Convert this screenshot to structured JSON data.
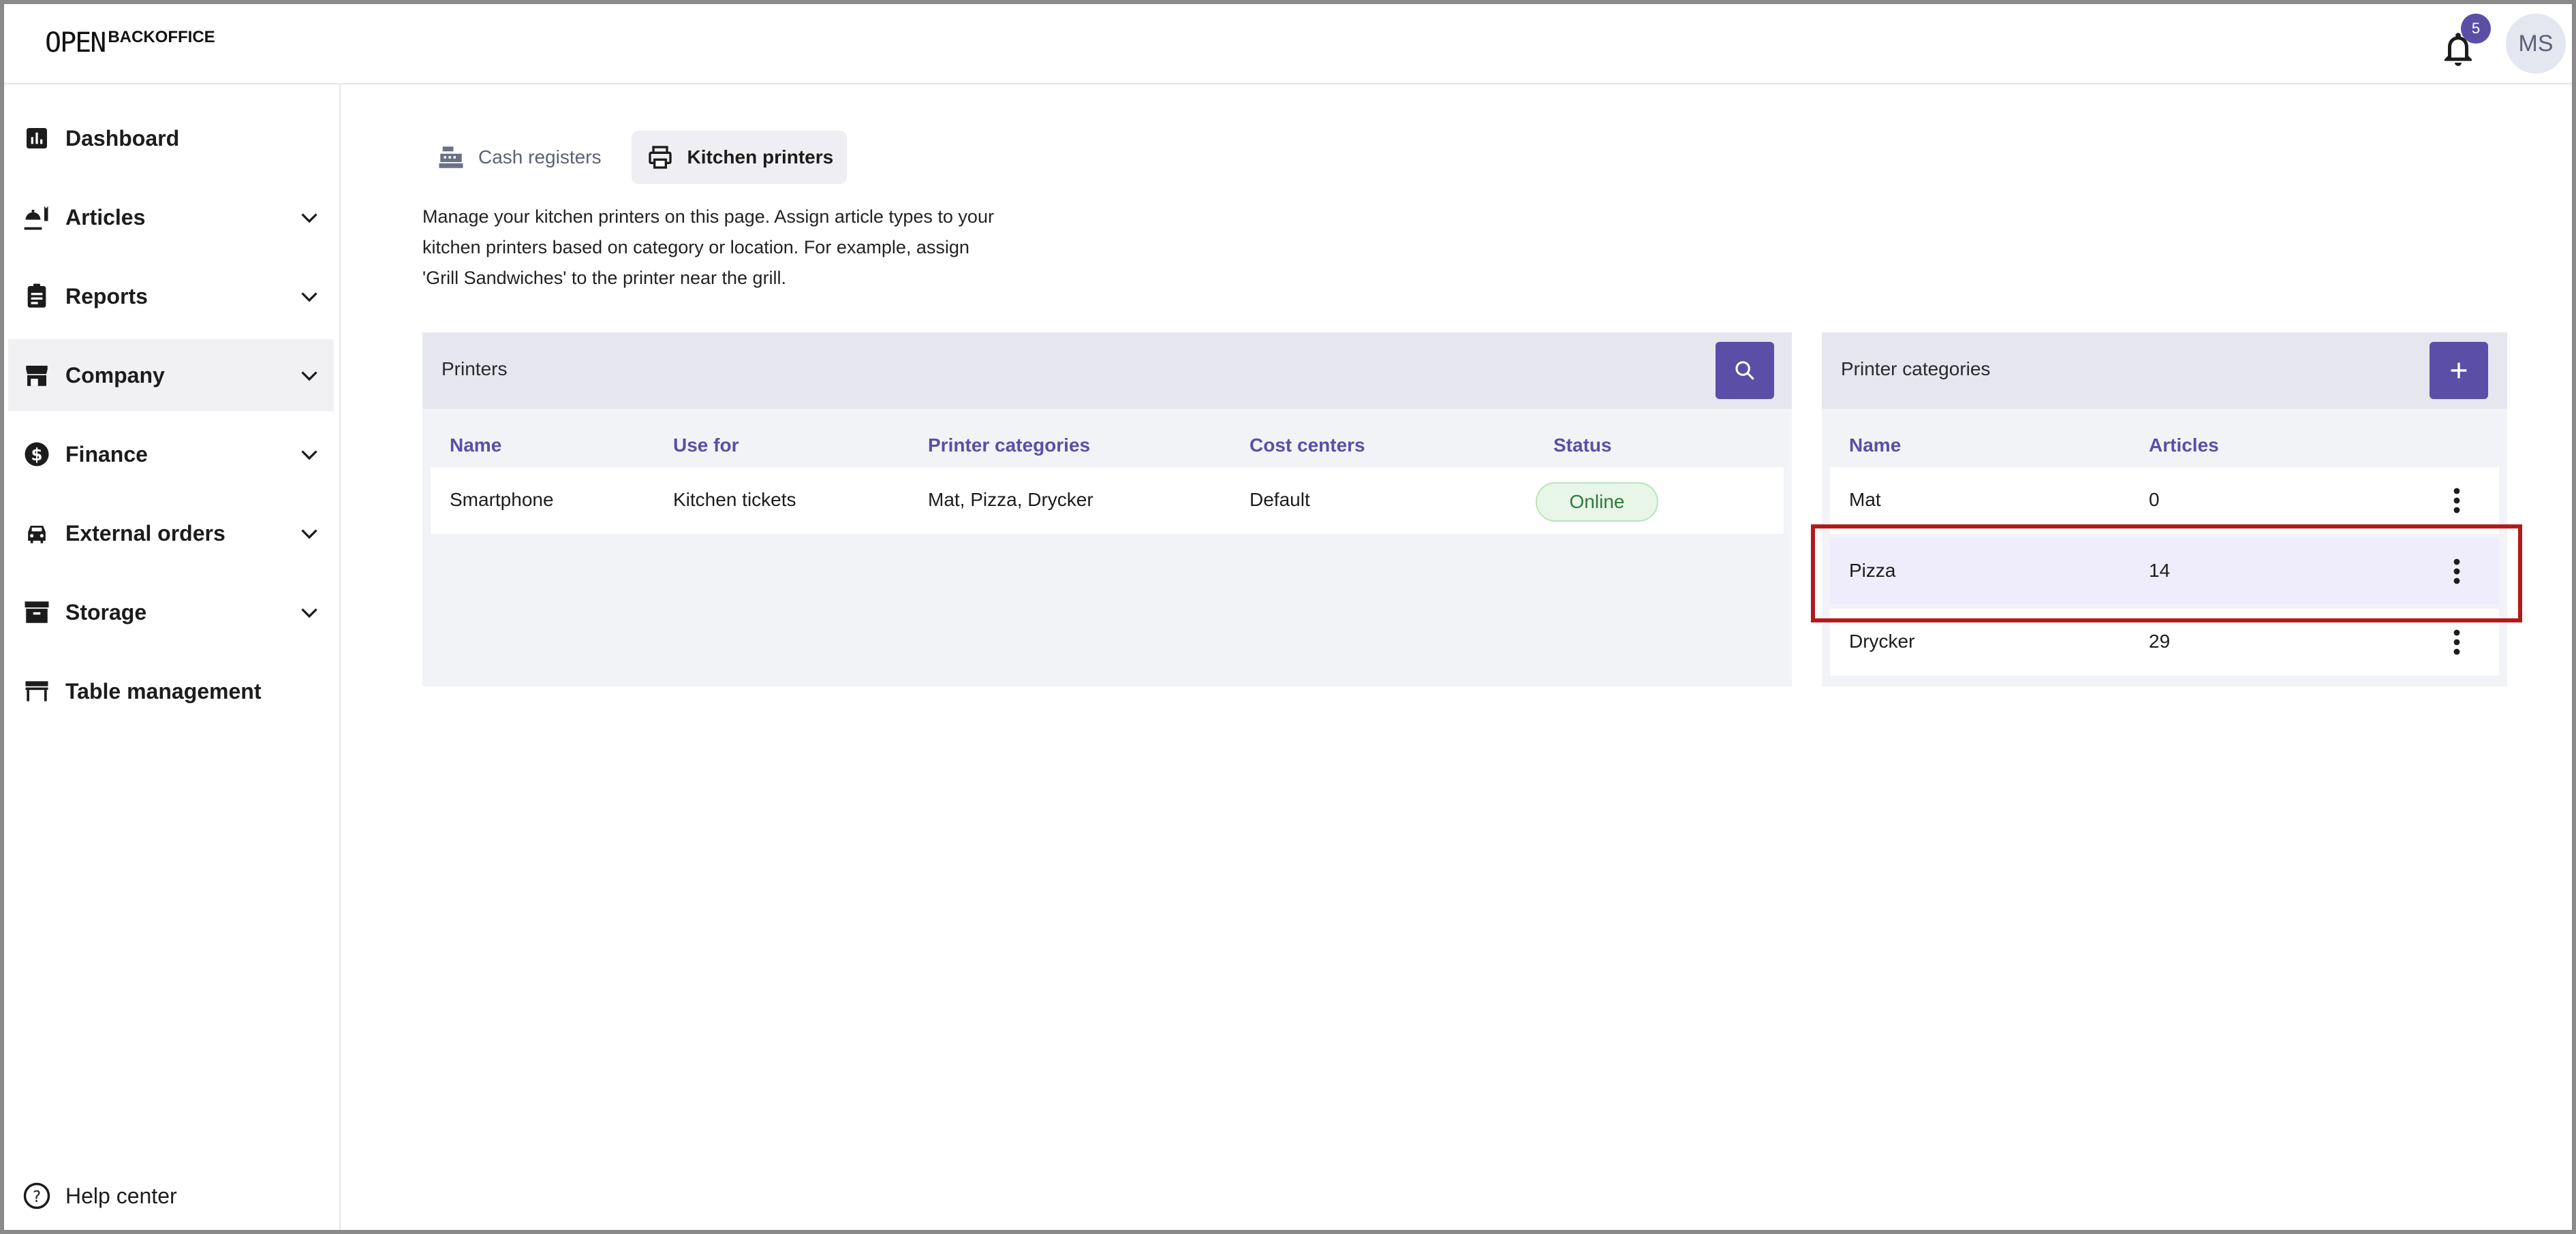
{
  "header": {
    "logo_mark": "OPEN",
    "logo_text": "BACKOFFICE",
    "notifications_count": "5",
    "avatar_initials": "MS"
  },
  "sidebar": {
    "items": [
      {
        "label": "Dashboard",
        "icon": "bar-chart-icon",
        "expandable": false
      },
      {
        "label": "Articles",
        "icon": "food-icon",
        "expandable": true
      },
      {
        "label": "Reports",
        "icon": "clipboard-icon",
        "expandable": true
      },
      {
        "label": "Company",
        "icon": "store-icon",
        "expandable": true,
        "active": true
      },
      {
        "label": "Finance",
        "icon": "dollar-icon",
        "expandable": true
      },
      {
        "label": "External orders",
        "icon": "car-icon",
        "expandable": true
      },
      {
        "label": "Storage",
        "icon": "archive-icon",
        "expandable": true
      },
      {
        "label": "Table management",
        "icon": "table-icon",
        "expandable": false
      }
    ],
    "help_label": "Help center"
  },
  "tabs": [
    {
      "label": "Cash registers",
      "icon": "cash-register-icon",
      "active": false
    },
    {
      "label": "Kitchen printers",
      "icon": "printer-icon",
      "active": true
    }
  ],
  "intro": {
    "line1": "Manage your kitchen printers on this page. Assign article types to your",
    "line2": "kitchen printers based on category or location. For example, assign",
    "line3": "'Grill Sandwiches' to the printer near the grill."
  },
  "printers_panel": {
    "title": "Printers",
    "columns": [
      "Name",
      "Use for",
      "Printer categories",
      "Cost centers",
      "Status"
    ],
    "rows": [
      {
        "name": "Smartphone",
        "use_for": "Kitchen tickets",
        "categories": "Mat, Pizza, Drycker",
        "cost_centers": "Default",
        "status": "Online"
      }
    ]
  },
  "categories_panel": {
    "title": "Printer categories",
    "columns": [
      "Name",
      "Articles"
    ],
    "rows": [
      {
        "name": "Mat",
        "articles": "0"
      },
      {
        "name": "Pizza",
        "articles": "14",
        "highlighted": true
      },
      {
        "name": "Drycker",
        "articles": "29"
      }
    ]
  },
  "colors": {
    "accent": "#5b4ea6",
    "highlight_row": "#efedfb",
    "annotation": "#b31a1a",
    "status_online_bg": "#e7f6e7"
  }
}
